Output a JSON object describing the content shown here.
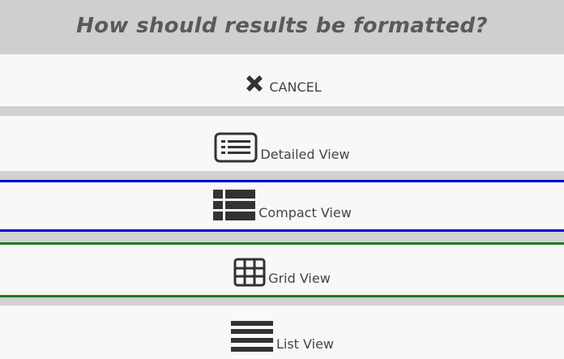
{
  "dialog": {
    "title": "How should results be formatted?"
  },
  "options": [
    {
      "label": "CANCEL",
      "icon": "close-icon"
    },
    {
      "label": "Detailed View",
      "icon": "detailed-view-icon"
    },
    {
      "label": "Compact View",
      "icon": "compact-view-icon"
    },
    {
      "label": "Grid View",
      "icon": "grid-view-icon"
    },
    {
      "label": "List View",
      "icon": "list-view-icon"
    }
  ],
  "colors": {
    "compact_border": "#0000d6",
    "grid_border": "#1e7a1e",
    "icon": "#333333"
  }
}
